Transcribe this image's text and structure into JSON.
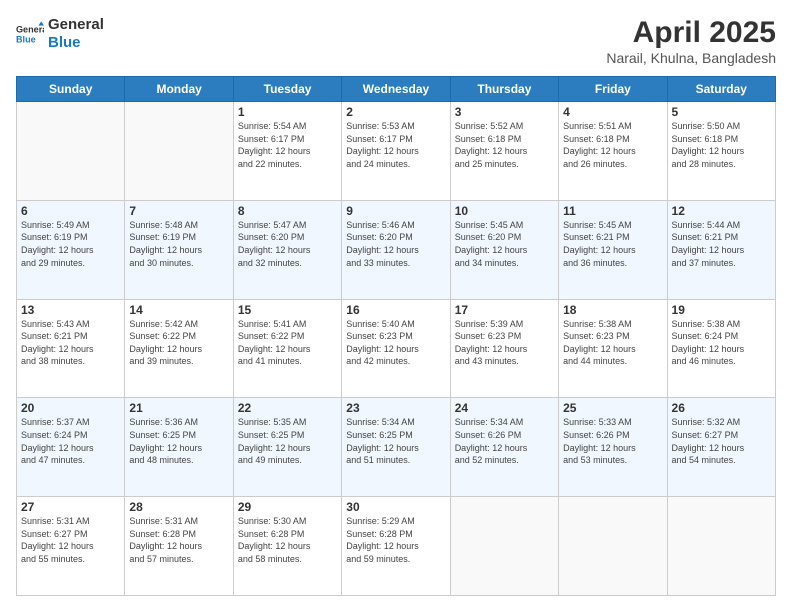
{
  "header": {
    "logo_line1": "General",
    "logo_line2": "Blue",
    "month_title": "April 2025",
    "location": "Narail, Khulna, Bangladesh"
  },
  "days_of_week": [
    "Sunday",
    "Monday",
    "Tuesday",
    "Wednesday",
    "Thursday",
    "Friday",
    "Saturday"
  ],
  "weeks": [
    [
      {
        "day": "",
        "info": ""
      },
      {
        "day": "",
        "info": ""
      },
      {
        "day": "1",
        "info": "Sunrise: 5:54 AM\nSunset: 6:17 PM\nDaylight: 12 hours\nand 22 minutes."
      },
      {
        "day": "2",
        "info": "Sunrise: 5:53 AM\nSunset: 6:17 PM\nDaylight: 12 hours\nand 24 minutes."
      },
      {
        "day": "3",
        "info": "Sunrise: 5:52 AM\nSunset: 6:18 PM\nDaylight: 12 hours\nand 25 minutes."
      },
      {
        "day": "4",
        "info": "Sunrise: 5:51 AM\nSunset: 6:18 PM\nDaylight: 12 hours\nand 26 minutes."
      },
      {
        "day": "5",
        "info": "Sunrise: 5:50 AM\nSunset: 6:18 PM\nDaylight: 12 hours\nand 28 minutes."
      }
    ],
    [
      {
        "day": "6",
        "info": "Sunrise: 5:49 AM\nSunset: 6:19 PM\nDaylight: 12 hours\nand 29 minutes."
      },
      {
        "day": "7",
        "info": "Sunrise: 5:48 AM\nSunset: 6:19 PM\nDaylight: 12 hours\nand 30 minutes."
      },
      {
        "day": "8",
        "info": "Sunrise: 5:47 AM\nSunset: 6:20 PM\nDaylight: 12 hours\nand 32 minutes."
      },
      {
        "day": "9",
        "info": "Sunrise: 5:46 AM\nSunset: 6:20 PM\nDaylight: 12 hours\nand 33 minutes."
      },
      {
        "day": "10",
        "info": "Sunrise: 5:45 AM\nSunset: 6:20 PM\nDaylight: 12 hours\nand 34 minutes."
      },
      {
        "day": "11",
        "info": "Sunrise: 5:45 AM\nSunset: 6:21 PM\nDaylight: 12 hours\nand 36 minutes."
      },
      {
        "day": "12",
        "info": "Sunrise: 5:44 AM\nSunset: 6:21 PM\nDaylight: 12 hours\nand 37 minutes."
      }
    ],
    [
      {
        "day": "13",
        "info": "Sunrise: 5:43 AM\nSunset: 6:21 PM\nDaylight: 12 hours\nand 38 minutes."
      },
      {
        "day": "14",
        "info": "Sunrise: 5:42 AM\nSunset: 6:22 PM\nDaylight: 12 hours\nand 39 minutes."
      },
      {
        "day": "15",
        "info": "Sunrise: 5:41 AM\nSunset: 6:22 PM\nDaylight: 12 hours\nand 41 minutes."
      },
      {
        "day": "16",
        "info": "Sunrise: 5:40 AM\nSunset: 6:23 PM\nDaylight: 12 hours\nand 42 minutes."
      },
      {
        "day": "17",
        "info": "Sunrise: 5:39 AM\nSunset: 6:23 PM\nDaylight: 12 hours\nand 43 minutes."
      },
      {
        "day": "18",
        "info": "Sunrise: 5:38 AM\nSunset: 6:23 PM\nDaylight: 12 hours\nand 44 minutes."
      },
      {
        "day": "19",
        "info": "Sunrise: 5:38 AM\nSunset: 6:24 PM\nDaylight: 12 hours\nand 46 minutes."
      }
    ],
    [
      {
        "day": "20",
        "info": "Sunrise: 5:37 AM\nSunset: 6:24 PM\nDaylight: 12 hours\nand 47 minutes."
      },
      {
        "day": "21",
        "info": "Sunrise: 5:36 AM\nSunset: 6:25 PM\nDaylight: 12 hours\nand 48 minutes."
      },
      {
        "day": "22",
        "info": "Sunrise: 5:35 AM\nSunset: 6:25 PM\nDaylight: 12 hours\nand 49 minutes."
      },
      {
        "day": "23",
        "info": "Sunrise: 5:34 AM\nSunset: 6:25 PM\nDaylight: 12 hours\nand 51 minutes."
      },
      {
        "day": "24",
        "info": "Sunrise: 5:34 AM\nSunset: 6:26 PM\nDaylight: 12 hours\nand 52 minutes."
      },
      {
        "day": "25",
        "info": "Sunrise: 5:33 AM\nSunset: 6:26 PM\nDaylight: 12 hours\nand 53 minutes."
      },
      {
        "day": "26",
        "info": "Sunrise: 5:32 AM\nSunset: 6:27 PM\nDaylight: 12 hours\nand 54 minutes."
      }
    ],
    [
      {
        "day": "27",
        "info": "Sunrise: 5:31 AM\nSunset: 6:27 PM\nDaylight: 12 hours\nand 55 minutes."
      },
      {
        "day": "28",
        "info": "Sunrise: 5:31 AM\nSunset: 6:28 PM\nDaylight: 12 hours\nand 57 minutes."
      },
      {
        "day": "29",
        "info": "Sunrise: 5:30 AM\nSunset: 6:28 PM\nDaylight: 12 hours\nand 58 minutes."
      },
      {
        "day": "30",
        "info": "Sunrise: 5:29 AM\nSunset: 6:28 PM\nDaylight: 12 hours\nand 59 minutes."
      },
      {
        "day": "",
        "info": ""
      },
      {
        "day": "",
        "info": ""
      },
      {
        "day": "",
        "info": ""
      }
    ]
  ]
}
